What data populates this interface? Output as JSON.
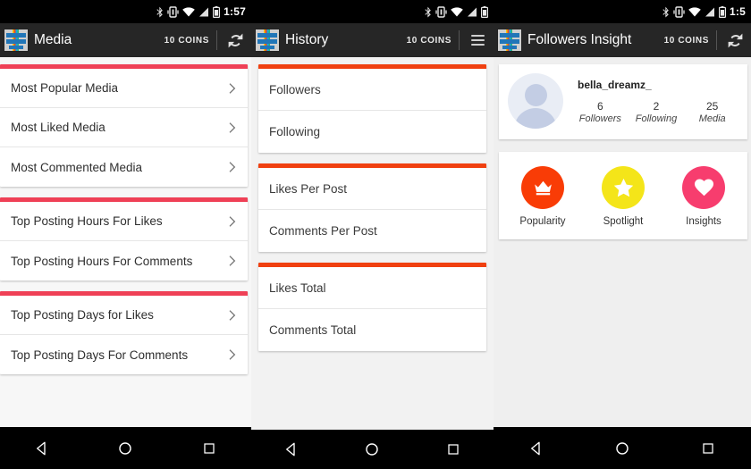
{
  "panels": [
    {
      "id": "media",
      "statusbar": {
        "time": "1:57",
        "icons": [
          "bluetooth-icon",
          "vibrate-icon",
          "wifi-icon",
          "signal-icon",
          "battery-icon"
        ]
      },
      "toolbar": {
        "logo": "app-logo-icon",
        "title": "Media",
        "coins": "10 COINS",
        "action": "refresh-icon"
      },
      "groups": [
        {
          "accent": "#ef4056",
          "rows": [
            {
              "label": "Most Popular Media",
              "chevron": true
            },
            {
              "label": "Most Liked Media",
              "chevron": true
            },
            {
              "label": "Most Commented Media",
              "chevron": true
            }
          ]
        },
        {
          "accent": "#ef4056",
          "rows": [
            {
              "label": "Top Posting Hours For Likes",
              "chevron": true
            },
            {
              "label": "Top Posting Hours For Comments",
              "chevron": true
            }
          ]
        },
        {
          "accent": "#ef4056",
          "rows": [
            {
              "label": "Top Posting Days for Likes",
              "chevron": true
            },
            {
              "label": "Top Posting Days For Comments",
              "chevron": true
            }
          ]
        }
      ],
      "navbar": [
        "back-icon",
        "home-icon",
        "recents-icon"
      ]
    },
    {
      "id": "history",
      "statusbar": {
        "time": "",
        "icons": [
          "bluetooth-icon",
          "vibrate-icon",
          "wifi-icon",
          "signal-icon",
          "battery-icon"
        ]
      },
      "toolbar": {
        "logo": "app-logo-icon",
        "title": "History",
        "coins": "10 COINS",
        "action": "menu-icon"
      },
      "groups": [
        {
          "accent": "#f04010",
          "rows": [
            {
              "label": "Followers",
              "chevron": false
            },
            {
              "label": "Following",
              "chevron": false
            }
          ]
        },
        {
          "accent": "#f04010",
          "rows": [
            {
              "label": "Likes Per Post",
              "chevron": false
            },
            {
              "label": "Comments Per Post",
              "chevron": false
            }
          ]
        },
        {
          "accent": "#f04010",
          "rows": [
            {
              "label": "Likes Total",
              "chevron": false
            },
            {
              "label": "Comments Total",
              "chevron": false
            }
          ]
        }
      ],
      "navbar": [
        "back-icon",
        "home-icon",
        "recents-icon"
      ]
    },
    {
      "id": "followers-insight",
      "statusbar": {
        "time": "1:5",
        "icons": [
          "bluetooth-icon",
          "vibrate-icon",
          "wifi-icon",
          "signal-icon",
          "battery-icon"
        ]
      },
      "toolbar": {
        "logo": "app-logo-icon",
        "title": "Followers Insight",
        "coins": "10 COINS",
        "action": "refresh-icon"
      },
      "profile": {
        "avatar": "default-avatar-icon",
        "username": "bella_dreamz_",
        "stats": [
          {
            "value": "6",
            "label": "Followers"
          },
          {
            "value": "2",
            "label": "Following"
          },
          {
            "value": "25",
            "label": "Media"
          }
        ]
      },
      "shortcuts": [
        {
          "label": "Popularity",
          "icon": "crown-icon",
          "color": "#f93c06"
        },
        {
          "label": "Spotlight",
          "icon": "star-icon",
          "color": "#f4e519"
        },
        {
          "label": "Insights",
          "icon": "heart-icon",
          "color": "#f73d6e"
        }
      ],
      "navbar": [
        "back-icon",
        "home-icon",
        "recents-icon"
      ]
    }
  ]
}
